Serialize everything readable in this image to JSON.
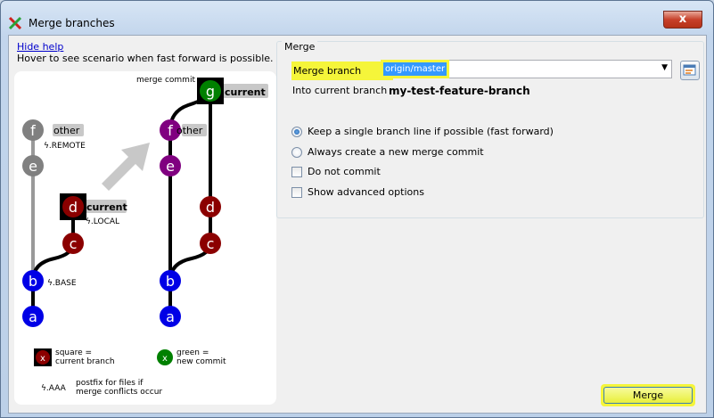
{
  "window": {
    "title": "Merge branches",
    "close_label": "x"
  },
  "help": {
    "hide_help_link": "Hide help",
    "hover_text": "Hover to see scenario when fast forward is possible."
  },
  "illustration": {
    "merge_commit_label": "merge commit",
    "left": {
      "other_label": "other",
      "remote_label": "ϟ.REMOTE",
      "current_label": "current",
      "local_label": "ϟ.LOCAL",
      "base_label": "ϟ.BASE",
      "nodes": [
        "f",
        "e",
        "d",
        "c",
        "b",
        "a"
      ]
    },
    "right": {
      "current_label": "current",
      "other_label": "other",
      "nodes": [
        "g",
        "f",
        "e",
        "d",
        "c",
        "b",
        "a"
      ]
    },
    "legend": {
      "square_symbol": "x",
      "square_text_1": "square =",
      "square_text_2": "current branch",
      "green_symbol": "x",
      "green_text_1": "green =",
      "green_text_2": "new commit",
      "postfix_symbol": "ϟ.AAA",
      "postfix_text_1": "postfix for files if",
      "postfix_text_2": "merge conflicts occur"
    }
  },
  "merge": {
    "group_title": "Merge",
    "merge_branch_label": "Merge branch",
    "merge_branch_value": "origin/master",
    "into_label": "Into current branch",
    "into_value": "my-test-feature-branch",
    "options": {
      "fast_forward": "Keep a single branch line if possible (fast forward)",
      "always_new": "Always create a new merge commit",
      "no_commit": "Do not commit",
      "advanced": "Show advanced options"
    },
    "merge_button": "Merge"
  },
  "colors": {
    "highlight": "#f5f53a",
    "node_grey": "#808080",
    "node_red": "#8b0000",
    "node_blue": "#0000e6",
    "node_purple": "#800080",
    "node_green": "#008000"
  }
}
